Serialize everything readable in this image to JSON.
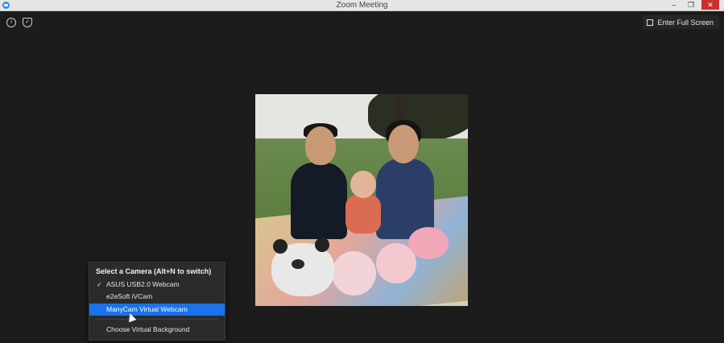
{
  "window": {
    "title": "Zoom Meeting",
    "controls": {
      "minimize": "–",
      "restore": "❐",
      "close": "✕"
    }
  },
  "toolbar": {
    "info_icon": "i",
    "shield_icon": "✓",
    "fullscreen_label": "Enter Full Screen"
  },
  "camera_menu": {
    "title": "Select a Camera (Alt+N to switch)",
    "items": [
      {
        "label": "ASUS USB2.0 Webcam",
        "checked": true,
        "check_glyph": "✓"
      },
      {
        "label": "e2eSoft iVCam",
        "checked": false
      },
      {
        "label": "ManyCam Virtual Webcam",
        "checked": false,
        "highlighted": true
      }
    ],
    "virtual_background": "Choose Virtual Background"
  },
  "colors": {
    "highlight": "#1a73e8",
    "close_button": "#c9302c",
    "background": "#1c1c1c"
  }
}
